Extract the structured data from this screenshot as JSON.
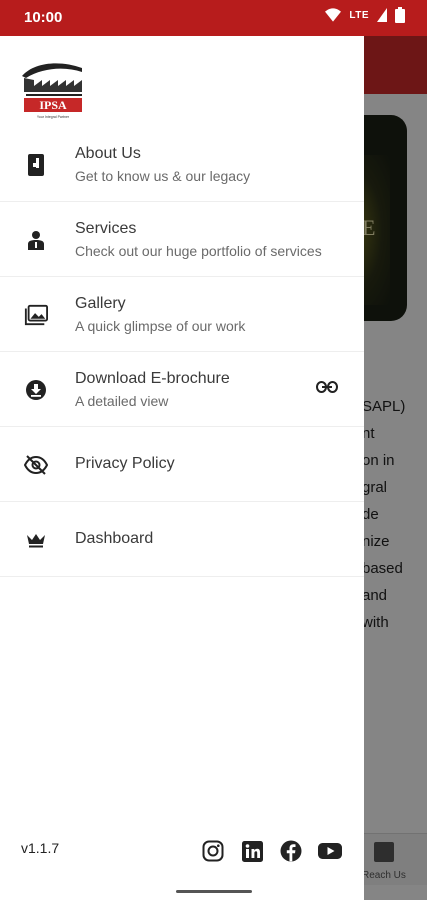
{
  "status_bar": {
    "time": "10:00",
    "network": "LTE"
  },
  "drawer": {
    "logo_text": "IPSA",
    "logo_tagline": "Your Integral Partner",
    "items": [
      {
        "title": "About Us",
        "subtitle": "Get to know us & our legacy",
        "icon": "book-icon"
      },
      {
        "title": "Services",
        "subtitle": "Check out our huge portfolio of services",
        "icon": "person-icon"
      },
      {
        "title": "Gallery",
        "subtitle": "A quick glimpse of our work",
        "icon": "photo-library-icon"
      },
      {
        "title": "Download E-brochure",
        "subtitle": "A detailed view",
        "icon": "download-circle-icon",
        "trailing_icon": "link-icon"
      },
      {
        "title": "Privacy Policy",
        "icon": "eye-off-icon"
      },
      {
        "title": "Dashboard",
        "icon": "crown-icon"
      }
    ],
    "version": "v1.1.7",
    "social": [
      "instagram-icon",
      "linkedin-icon",
      "facebook-icon",
      "youtube-icon"
    ]
  },
  "background": {
    "card_letter": "E",
    "text_lines": [
      "SAPL)",
      "nt",
      "on in",
      "gral",
      "de",
      "nize",
      "based",
      "and",
      "with"
    ],
    "nav_label": "Reach Us"
  },
  "colors": {
    "status_bar": "#b71c1c",
    "app_bar": "#c62828",
    "text_primary": "#3a3a3a",
    "text_secondary": "#6a6a6a"
  }
}
